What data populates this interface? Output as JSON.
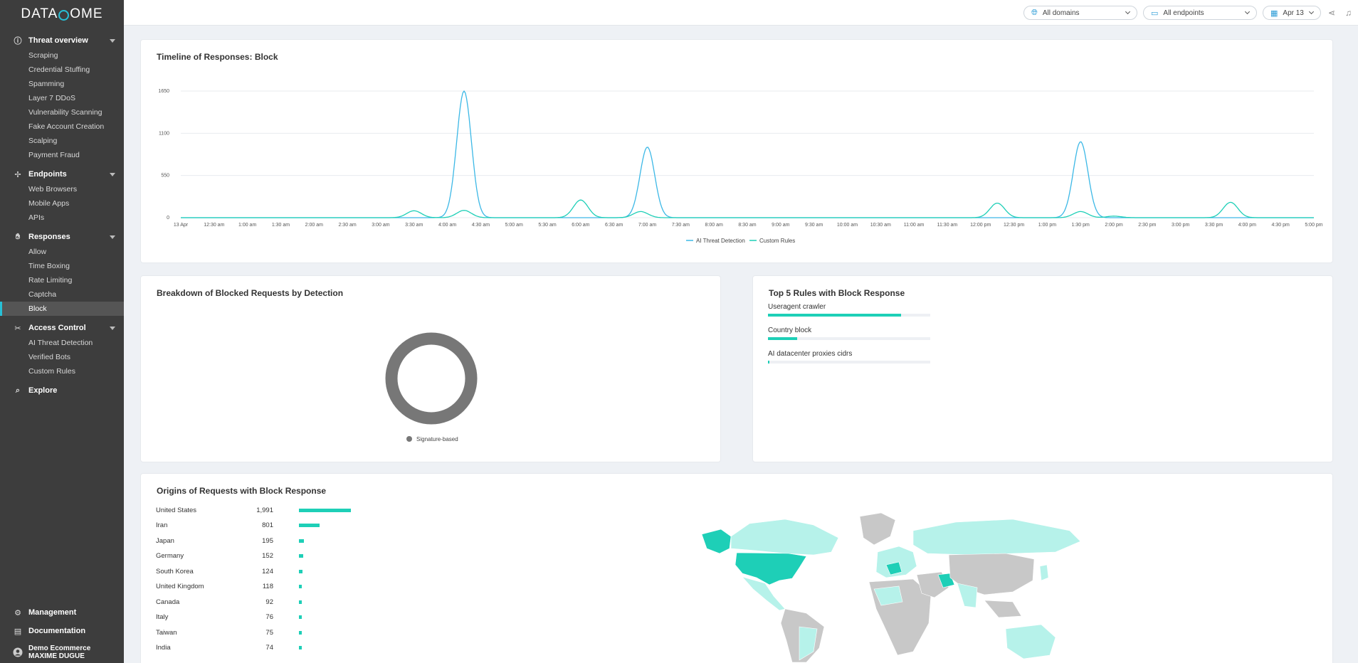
{
  "sidebar": {
    "logo": {
      "left": "DATA",
      "right": "OME"
    },
    "sections": [
      {
        "label": "Threat overview",
        "icon": "alert-circle-icon",
        "items": [
          "Scraping",
          "Credential Stuffing",
          "Spamming",
          "Layer 7 DDoS",
          "Vulnerability Scanning",
          "Fake Account Creation",
          "Scalping",
          "Payment Fraud"
        ]
      },
      {
        "label": "Endpoints",
        "icon": "endpoints-icon",
        "items": [
          "Web Browsers",
          "Mobile Apps",
          "APIs"
        ]
      },
      {
        "label": "Responses",
        "icon": "hand-icon",
        "items": [
          "Allow",
          "Time Boxing",
          "Rate Limiting",
          "Captcha",
          "Block"
        ]
      },
      {
        "label": "Access Control",
        "icon": "tools-icon",
        "items": [
          "AI Threat Detection",
          "Verified Bots",
          "Custom Rules"
        ]
      },
      {
        "label": "Explore",
        "icon": "explore-icon",
        "items": []
      }
    ],
    "active_item": "Block",
    "bottom": {
      "management": "Management",
      "documentation": "Documentation",
      "user_line1": "Demo Ecommerce",
      "user_line2": "MAXIME DUGUE"
    }
  },
  "topbar": {
    "domains": "All domains",
    "endpoints": "All endpoints",
    "date": "Apr 13"
  },
  "timeline": {
    "title": "Timeline of Responses: Block",
    "legend": [
      "AI Threat Detection",
      "Custom Rules"
    ],
    "chart_data": {
      "type": "line",
      "title": "Timeline of Responses: Block",
      "x_labels": [
        "13 Apr",
        "12:30 am",
        "1:00 am",
        "1:30 am",
        "2:00 am",
        "2:30 am",
        "3:00 am",
        "3:30 am",
        "4:00 am",
        "4:30 am",
        "5:00 am",
        "5:30 am",
        "6:00 am",
        "6:30 am",
        "7:00 am",
        "7:30 am",
        "8:00 am",
        "8:30 am",
        "9:00 am",
        "9:30 am",
        "10:00 am",
        "10:30 am",
        "11:00 am",
        "11:30 am",
        "12:00 pm",
        "12:30 pm",
        "1:00 pm",
        "1:30 pm",
        "2:00 pm",
        "2:30 pm",
        "3:00 pm",
        "3:30 pm",
        "4:00 pm",
        "4:30 pm",
        "5:00 pm"
      ],
      "y_ticks": [
        0,
        550,
        1100,
        1650
      ],
      "ylim": [
        0,
        1650
      ],
      "series": [
        {
          "name": "AI Threat Detection",
          "color": "#3cb8e6",
          "peaks": [
            {
              "x": 8.5,
              "y": 1650
            },
            {
              "x": 14.0,
              "y": 920
            },
            {
              "x": 27.0,
              "y": 990
            }
          ]
        },
        {
          "name": "Custom Rules",
          "color": "#1ecfb7",
          "peaks": [
            {
              "x": 7.0,
              "y": 90
            },
            {
              "x": 8.5,
              "y": 95
            },
            {
              "x": 12.0,
              "y": 230
            },
            {
              "x": 13.8,
              "y": 80
            },
            {
              "x": 24.5,
              "y": 190
            },
            {
              "x": 27.0,
              "y": 80
            },
            {
              "x": 28.0,
              "y": 20
            },
            {
              "x": 31.5,
              "y": 200
            }
          ]
        }
      ]
    }
  },
  "breakdown": {
    "title": "Breakdown of Blocked Requests by Detection",
    "chart_data": {
      "type": "pie",
      "slices": [
        {
          "name": "Signature-based",
          "value": 100,
          "color": "#777777"
        }
      ]
    }
  },
  "top_rules": {
    "title": "Top 5 Rules with Block Response",
    "rules": [
      {
        "name": "Useragent crawler",
        "fraction": 0.82
      },
      {
        "name": "Country block",
        "fraction": 0.18
      },
      {
        "name": "AI datacenter proxies cidrs",
        "fraction": 0.01
      }
    ]
  },
  "origins": {
    "title": "Origins of Requests with Block Response",
    "rows": [
      {
        "country": "United States",
        "value": "1,991",
        "n": 1991
      },
      {
        "country": "Iran",
        "value": "801",
        "n": 801
      },
      {
        "country": "Japan",
        "value": "195",
        "n": 195
      },
      {
        "country": "Germany",
        "value": "152",
        "n": 152
      },
      {
        "country": "South Korea",
        "value": "124",
        "n": 124
      },
      {
        "country": "United Kingdom",
        "value": "118",
        "n": 118
      },
      {
        "country": "Canada",
        "value": "92",
        "n": 92
      },
      {
        "country": "Italy",
        "value": "76",
        "n": 76
      },
      {
        "country": "Taiwan",
        "value": "75",
        "n": 75
      },
      {
        "country": "India",
        "value": "74",
        "n": 74
      }
    ],
    "colors": {
      "high": "#1ecfb7",
      "low": "#b6f2ea",
      "none": "#c8c8c8"
    }
  }
}
